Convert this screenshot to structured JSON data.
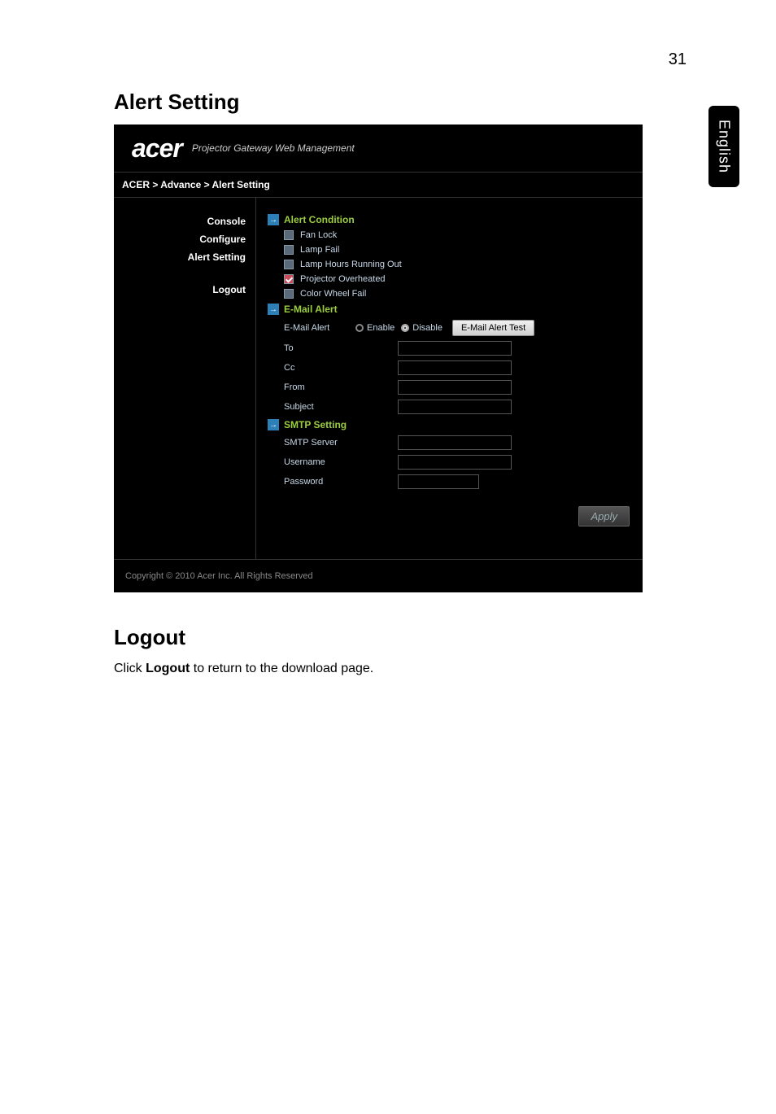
{
  "page_number": "31",
  "side_tab": "English",
  "section1_title": "Alert Setting",
  "screenshot": {
    "logo": "acer",
    "header_subtitle": "Projector Gateway Web Management",
    "breadcrumb": "ACER > Advance > Alert Setting",
    "sidebar": {
      "items": [
        "Console",
        "Configure",
        "Alert Setting"
      ],
      "logout": "Logout"
    },
    "alert_condition": {
      "header": "Alert Condition",
      "fan_lock": "Fan Lock",
      "lamp_fail": "Lamp Fail",
      "lamp_hours": "Lamp Hours Running Out",
      "projector_overheated": "Projector Overheated",
      "color_wheel_fail": "Color Wheel Fail"
    },
    "email_alert": {
      "header": "E-Mail Alert",
      "label": "E-Mail Alert",
      "enable": "Enable",
      "disable": "Disable",
      "test_button": "E-Mail Alert Test",
      "to": "To",
      "cc": "Cc",
      "from": "From",
      "subject": "Subject"
    },
    "smtp": {
      "header": "SMTP Setting",
      "server": "SMTP Server",
      "username": "Username",
      "password": "Password"
    },
    "apply": "Apply",
    "footer": "Copyright © 2010 Acer Inc. All Rights Reserved"
  },
  "section2_title": "Logout",
  "logout_text_prefix": "Click ",
  "logout_text_bold": "Logout",
  "logout_text_suffix": " to return to the download page."
}
